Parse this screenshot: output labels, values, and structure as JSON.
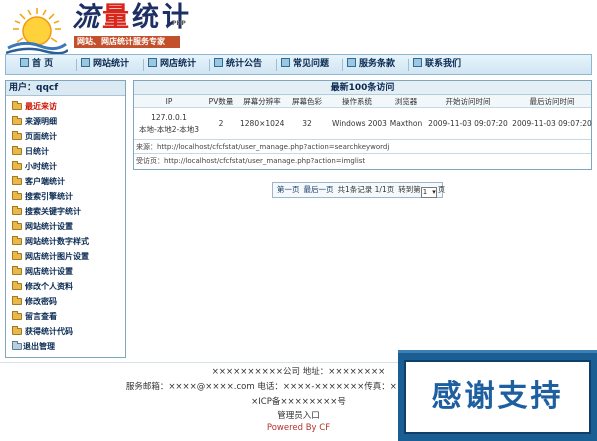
{
  "header": {
    "logo_title_first": "流",
    "logo_title_mid": "量",
    "logo_title_last": "统计",
    "logo_php": "PHP",
    "slogan": "网站、网店统计服务专家"
  },
  "nav": {
    "items": [
      {
        "label": "首 页"
      },
      {
        "label": "网站统计"
      },
      {
        "label": "网店统计"
      },
      {
        "label": "统计公告"
      },
      {
        "label": "常见问题"
      },
      {
        "label": "服务条款"
      },
      {
        "label": "联系我们"
      }
    ]
  },
  "sidebar": {
    "user_label": "用户：qqcf",
    "items": [
      {
        "label": "最近来访"
      },
      {
        "label": "来源明细"
      },
      {
        "label": "页面统计"
      },
      {
        "label": "日统计"
      },
      {
        "label": "小时统计"
      },
      {
        "label": "客户端统计"
      },
      {
        "label": "搜索引擎统计"
      },
      {
        "label": "搜索关键字统计"
      },
      {
        "label": "网站统计设置"
      },
      {
        "label": "网站统计数字样式"
      },
      {
        "label": "网店统计图片设置"
      },
      {
        "label": "网店统计设置"
      },
      {
        "label": "修改个人资料"
      },
      {
        "label": "修改密码"
      },
      {
        "label": "留言查看"
      },
      {
        "label": "获得统计代码"
      },
      {
        "label": "退出管理"
      }
    ]
  },
  "visits": {
    "title": "最新100条访问",
    "columns": [
      "IP",
      "PV数量",
      "屏幕分辨率",
      "屏幕色彩",
      "操作系统",
      "浏览器",
      "开始访问时间",
      "最后访问时间"
    ],
    "row": {
      "ip": "127.0.0.1",
      "location": "本地-本地2-本地3",
      "pv": "2",
      "resolution": "1280×1024",
      "color": "32",
      "os": "Windows 2003",
      "browser": "Maxthon",
      "start_time": "2009-11-03 09:07:20",
      "last_time": "2009-11-03 09:07:20"
    },
    "referrer": "来源：http://localhost/cfcfstat/user_manage.php?action=searchkeywordj",
    "visited": "受访页：http://localhost/cfcfstat/user_manage.php?action=imglist"
  },
  "pager": {
    "first": "第一页",
    "last": "最后一页",
    "summary": "共1条记录 1/1页",
    "goto": "转到第",
    "current": "1",
    "suffix": "页"
  },
  "footer": {
    "line1": "××××××××××公司 地址：××××××××",
    "line2": "服务邮箱：××××@××××.com 电话：××××-×××××××传真：××××-×××××××",
    "line3": "×ICP备××××××××号",
    "admin_link": "管理员入口",
    "powered": "Powered By CF"
  },
  "overlay": {
    "text": "感谢支持"
  },
  "colors": {
    "accent": "#1a5e93",
    "active_menu": "#cc1100",
    "powered": "#b2322a"
  }
}
